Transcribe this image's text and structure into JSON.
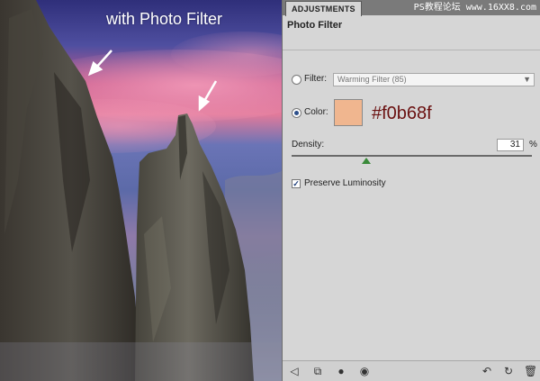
{
  "photo": {
    "caption": "with Photo Filter"
  },
  "panel": {
    "tab_label": "ADJUSTMENTS",
    "watermark": "PS教程论坛 www.16XX8.com",
    "title": "Photo Filter",
    "filter_label": "Filter:",
    "filter_value": "Warming Filter (85)",
    "color_label": "Color:",
    "color_hex": "#f0b68f",
    "color_value": "#f0b68f",
    "density_label": "Density:",
    "density_value": "31",
    "density_unit": "%",
    "density_fraction": 0.31,
    "preserve_label": "Preserve Luminosity",
    "preserve_checked": true,
    "selected_option": "color"
  },
  "icons": {
    "back": "back-arrow-icon",
    "clip": "clip-to-layer-icon",
    "mask": "layer-mask-icon",
    "visibility": "eye-visibility-icon",
    "preview": "preview-toggle-icon",
    "reset": "reset-icon",
    "delete": "trash-icon"
  }
}
